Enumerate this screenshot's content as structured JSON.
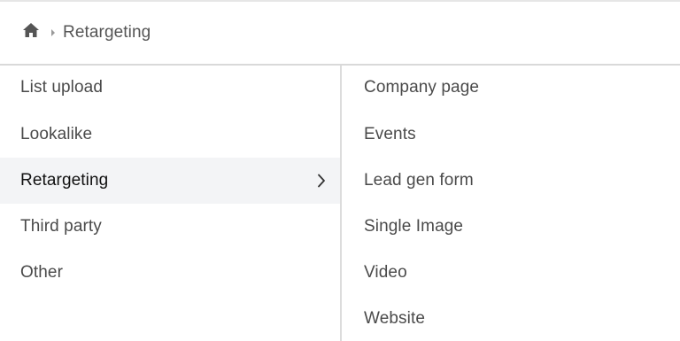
{
  "breadcrumb": {
    "home_icon": "home-icon",
    "separator_icon": "caret-right-icon",
    "current": "Retargeting"
  },
  "left_menu": {
    "items": [
      {
        "label": "List upload",
        "selected": false
      },
      {
        "label": "Lookalike",
        "selected": false
      },
      {
        "label": "Retargeting",
        "selected": true,
        "icon": "chevron-right-icon"
      },
      {
        "label": "Third party",
        "selected": false
      },
      {
        "label": "Other",
        "selected": false
      }
    ]
  },
  "right_menu": {
    "items": [
      {
        "label": "Company page"
      },
      {
        "label": "Events"
      },
      {
        "label": "Lead gen form"
      },
      {
        "label": "Single Image"
      },
      {
        "label": "Video"
      },
      {
        "label": "Website"
      }
    ]
  },
  "colors": {
    "selected_bg": "#f3f4f6",
    "divider": "#dcdcdc",
    "text": "#4a4a4a",
    "icon": "#555555"
  }
}
